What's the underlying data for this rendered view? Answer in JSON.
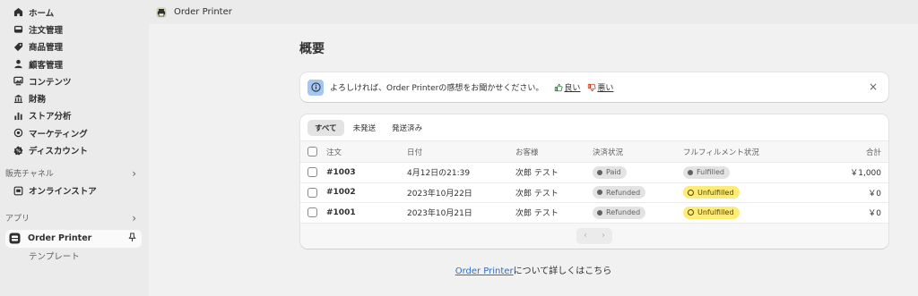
{
  "sidebar": {
    "items": [
      {
        "label": "ホーム",
        "icon": "home-icon"
      },
      {
        "label": "注文管理",
        "icon": "inbox-icon"
      },
      {
        "label": "商品管理",
        "icon": "tag-icon"
      },
      {
        "label": "顧客管理",
        "icon": "person-icon"
      },
      {
        "label": "コンテンツ",
        "icon": "image-icon"
      },
      {
        "label": "財務",
        "icon": "bank-icon"
      },
      {
        "label": "ストア分析",
        "icon": "bar-chart-icon"
      },
      {
        "label": "マーケティング",
        "icon": "target-icon"
      },
      {
        "label": "ディスカウント",
        "icon": "discount-icon"
      }
    ],
    "sales_channels_label": "販売チャネル",
    "online_store_label": "オンラインストア",
    "apps_label": "アプリ",
    "active_app_label": "Order Printer",
    "sub_item_label": "テンプレート"
  },
  "topbar": {
    "app_title": "Order Printer"
  },
  "page": {
    "title": "概要"
  },
  "banner": {
    "message": "よろしければ、Order Printerの感想をお聞かせください。",
    "good_label": "良い",
    "bad_label": "悪い",
    "close_glyph": "×"
  },
  "tabs": [
    "すべて",
    "未発送",
    "発送済み"
  ],
  "table": {
    "headers": {
      "order": "注文",
      "date": "日付",
      "customer": "お客様",
      "payment": "決済状況",
      "fulfillment": "フルフィルメント状況",
      "total": "合計"
    },
    "rows": [
      {
        "order": "#1003",
        "date": "4月12日の21:39",
        "customer": "次郎 テスト",
        "payment": "Paid",
        "fulfillment": "Fulfilled",
        "total": "￥1,000"
      },
      {
        "order": "#1002",
        "date": "2023年10月22日",
        "customer": "次郎 テスト",
        "payment": "Refunded",
        "fulfillment": "Unfulfilled",
        "total": "￥0"
      },
      {
        "order": "#1001",
        "date": "2023年10月21日",
        "customer": "次郎 テスト",
        "payment": "Refunded",
        "fulfillment": "Unfulfilled",
        "total": "￥0"
      }
    ]
  },
  "pager": {
    "prev_glyph": "‹",
    "next_glyph": "›"
  },
  "footer": {
    "link_text": "Order Printer",
    "suffix": "について詳しくはこちら"
  },
  "colors": {
    "link": "#2c6ecb",
    "badge_yellow": "#ffeb78",
    "badge_gray": "#e3e3e3",
    "info_blue": "#a4c6f2"
  }
}
